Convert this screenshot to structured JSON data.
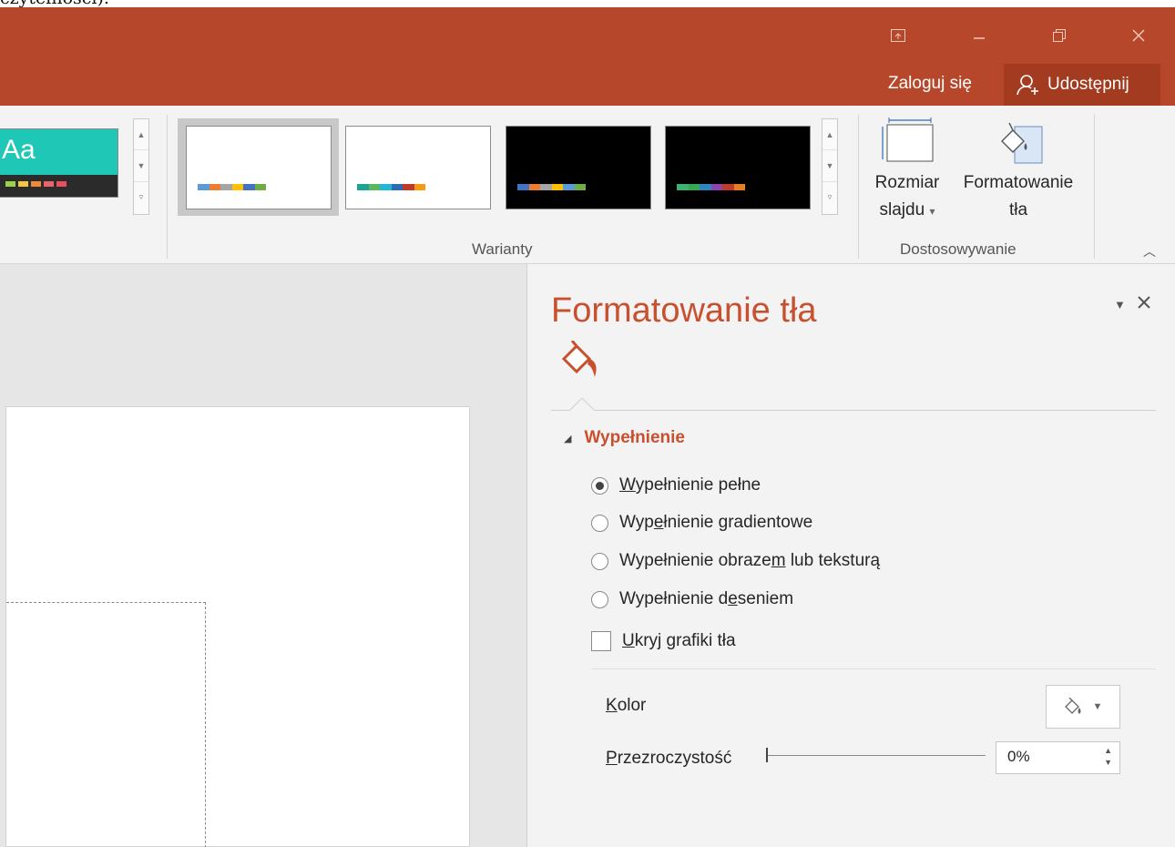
{
  "window_controls": {
    "ribbon_display_icon": "ribbon-display-options-icon",
    "minimize_icon": "minimize-icon",
    "restore_icon": "restore-icon",
    "close_icon": "close-icon"
  },
  "account": {
    "login_label": "Zaloguj się",
    "share_label": "Udostępnij"
  },
  "ribbon": {
    "themes": {
      "thumb_text": "Aa"
    },
    "variants_group": {
      "label": "Warianty",
      "items": [
        {
          "background": "#ffffff",
          "colors": [
            "#5b9bd5",
            "#ed7d31",
            "#a5a5a5",
            "#ffc000",
            "#4472c4",
            "#70ad47"
          ]
        },
        {
          "background": "#ffffff",
          "colors": [
            "#1ba393",
            "#5cb85c",
            "#23b6d7",
            "#2a6db5",
            "#c0392b",
            "#f39c12"
          ]
        },
        {
          "background": "#000000",
          "colors": [
            "#4472c4",
            "#ed7d31",
            "#a5a5a5",
            "#ffc000",
            "#5b9bd5",
            "#70ad47"
          ]
        },
        {
          "background": "#000000",
          "colors": [
            "#3cb371",
            "#34a853",
            "#2e86c1",
            "#8e44ad",
            "#c0392b",
            "#e67e22"
          ]
        }
      ]
    },
    "customize_group": {
      "label": "Dostosowywanie",
      "slide_size": {
        "line1": "Rozmiar",
        "line2": "slajdu",
        "dropdown": "▾"
      },
      "format_bg": {
        "line1": "Formatowanie",
        "line2": "tła"
      }
    }
  },
  "pane": {
    "title": "Formatowanie tła",
    "fill_tab_icon": "paint-bucket-icon",
    "section": {
      "label": "Wypełnienie",
      "options": [
        {
          "label_pre": "",
          "label_u": "W",
          "label_post": "ypełnienie pełne",
          "checked": true
        },
        {
          "label_pre": "Wyp",
          "label_u": "e",
          "label_post": "łnienie gradientowe",
          "checked": false
        },
        {
          "label_pre": "Wypełnienie obraze",
          "label_u": "m",
          "label_post": " lub teksturą",
          "checked": false
        },
        {
          "label_pre": "Wypełnienie d",
          "label_u": "e",
          "label_post": "seniem",
          "checked": false
        }
      ],
      "hide_graphics": {
        "label_u": "U",
        "label_post": "kryj grafiki tła",
        "checked": false
      }
    },
    "color": {
      "label_u": "K",
      "label_post": "olor"
    },
    "transparency": {
      "label_u": "P",
      "label_post": "rzezroczystość",
      "value": "0%",
      "level": 0
    }
  },
  "colors": {
    "titlebar": "#b7472a",
    "accent": "#c8502f"
  }
}
